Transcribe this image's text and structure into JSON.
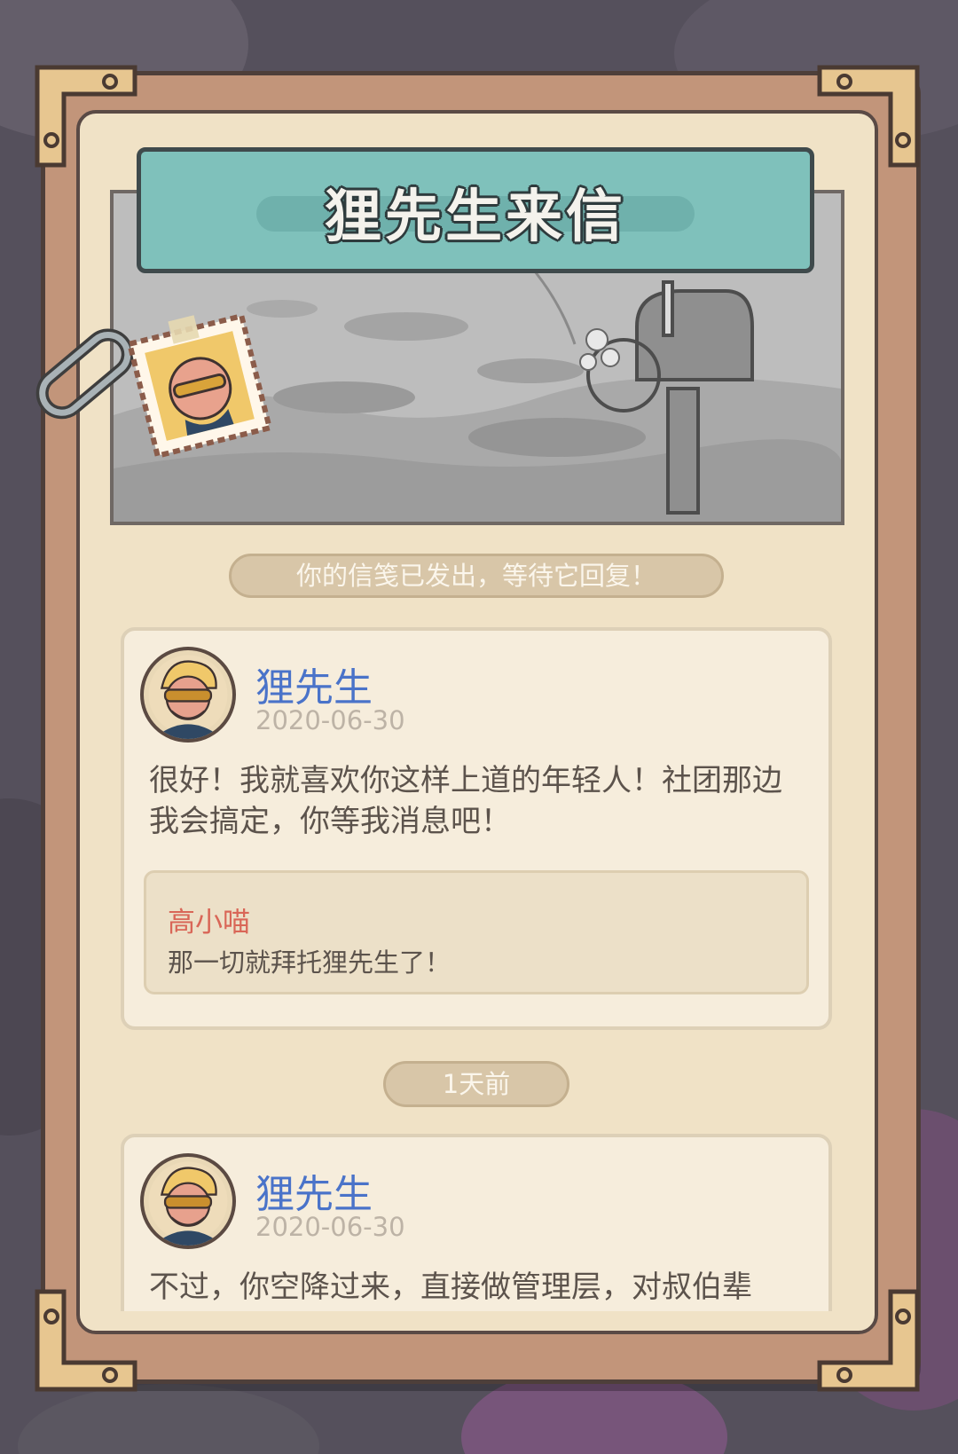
{
  "header": {
    "title": "狸先生来信"
  },
  "status": {
    "text": "你的信笺已发出，等待它回复！"
  },
  "messages": [
    {
      "sender": "狸先生",
      "date": "2020-06-30",
      "text": "很好！我就喜欢你这样上道的年轻人！社团那边我会搞定，你等我消息吧！",
      "reply": {
        "name": "高小喵",
        "text": "那一切就拜托狸先生了！"
      }
    },
    {
      "sender": "狸先生",
      "date": "2020-06-30",
      "text": "不过，你空降过来，直接做管理层，对叔伯辈"
    }
  ],
  "separator": {
    "text": "1天前"
  },
  "colors": {
    "title_plate": "#7fc1bb",
    "sender_name": "#4a73c9",
    "reply_name": "#d96657",
    "paper": "#f0e2c6",
    "board": "#c2957a"
  },
  "icons": [
    "carabiner-clip-icon",
    "stamp-portrait-icon",
    "mailbox-illustration",
    "avatar-portrait-icon"
  ]
}
